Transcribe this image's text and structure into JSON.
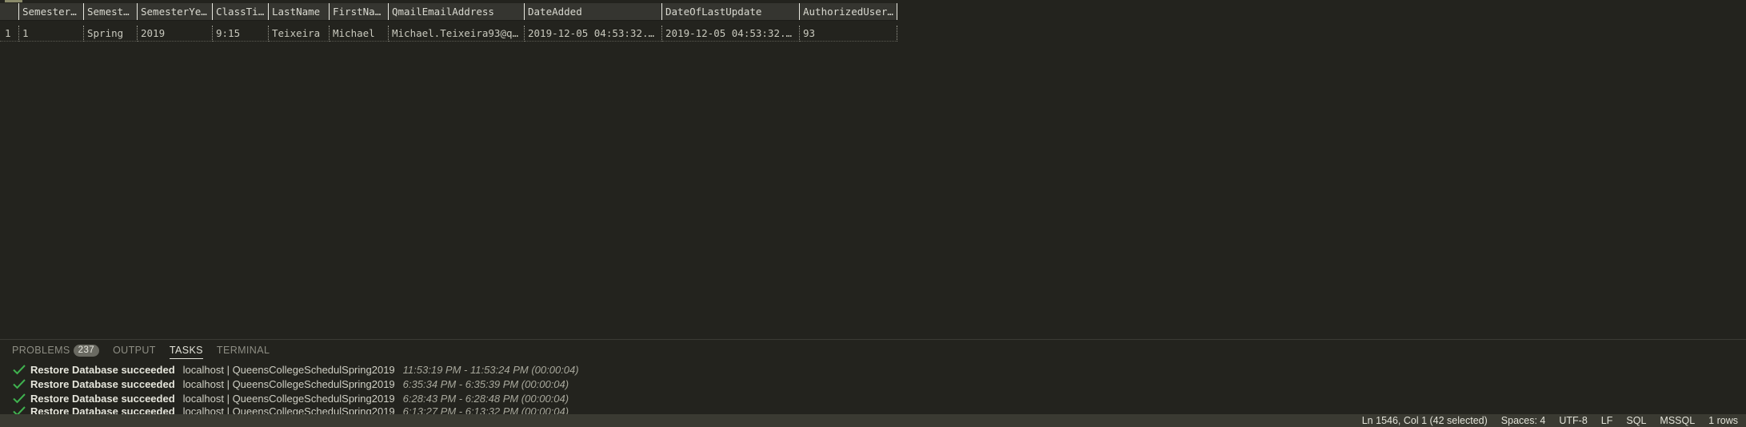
{
  "results": {
    "columns": [
      "SemesterID",
      "Semester",
      "SemesterYear",
      "ClassTime",
      "LastName",
      "FirstName",
      "QmailEmailAddress",
      "DateAdded",
      "DateOfLastUpdate",
      "AuthorizedUserId"
    ],
    "rows": [
      {
        "index": "1",
        "cells": [
          "1",
          "Spring",
          "2019",
          "9:15",
          "Teixeira",
          "Michael",
          "Michael.Teixeira93@q…",
          "2019-12-05 04:53:32.…",
          "2019-12-05 04:53:32.…",
          "93"
        ]
      }
    ]
  },
  "panel": {
    "tabs": [
      {
        "label": "PROBLEMS",
        "badge": "237"
      },
      {
        "label": "OUTPUT"
      },
      {
        "label": "TASKS"
      },
      {
        "label": "TERMINAL"
      }
    ],
    "active_tab": "TASKS",
    "tasks": [
      {
        "title": "Restore Database succeeded",
        "server": "localhost | QueensCollegeSchedulSpring2019",
        "time": "11:53:19 PM - 11:53:24 PM (00:00:04)"
      },
      {
        "title": "Restore Database succeeded",
        "server": "localhost | QueensCollegeSchedulSpring2019",
        "time": "6:35:34 PM - 6:35:39 PM (00:00:04)"
      },
      {
        "title": "Restore Database succeeded",
        "server": "localhost | QueensCollegeSchedulSpring2019",
        "time": "6:28:43 PM - 6:28:48 PM (00:00:04)"
      },
      {
        "title": "Restore Database succeeded",
        "server": "localhost | QueensCollegeSchedulSpring2019",
        "time": "6:13:27 PM - 6:13:32 PM (00:00:04)"
      }
    ],
    "success_color": "#3fb24f"
  },
  "statusbar": {
    "cursor": "Ln 1546, Col 1 (42 selected)",
    "spaces": "Spaces: 4",
    "encoding": "UTF-8",
    "eol": "LF",
    "language": "SQL",
    "connection": "MSSQL",
    "rows": "1 rows"
  }
}
